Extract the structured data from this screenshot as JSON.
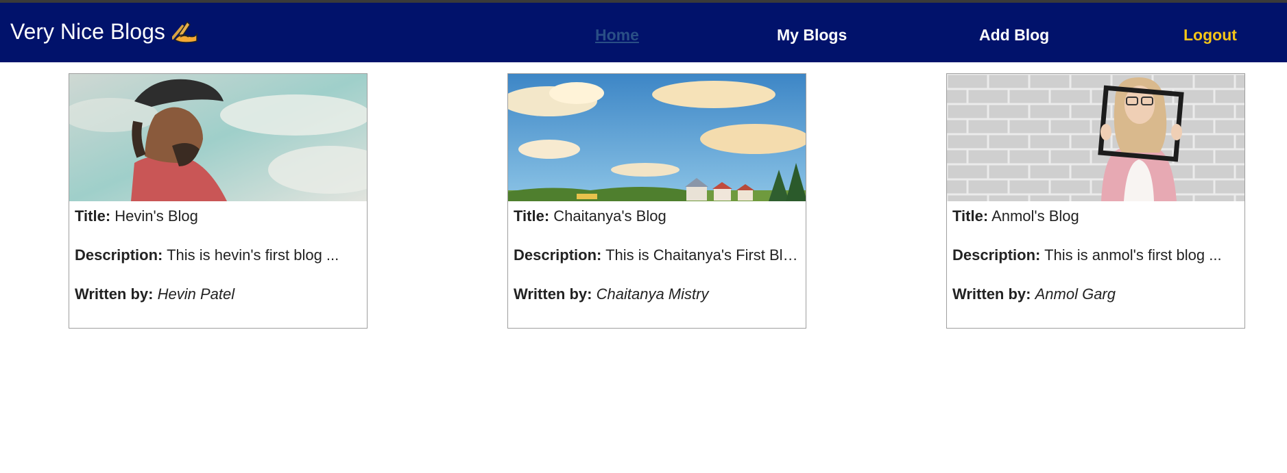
{
  "app": {
    "title": "Very Nice Blogs",
    "brand_icon": "writing-hand-icon"
  },
  "nav": {
    "home": "Home",
    "my_blogs": "My Blogs",
    "add_blog": "Add Blog",
    "logout": "Logout"
  },
  "labels": {
    "title": "Title:",
    "description": "Description:",
    "written_by": "Written by:"
  },
  "blogs": [
    {
      "title": "Hevin's Blog",
      "description": "This is hevin's first blog ...",
      "author": "Hevin Patel",
      "image": "man-in-cap-looking-at-sky"
    },
    {
      "title": "Chaitanya's Blog",
      "description": "This is Chaitanya's First Bl…",
      "author": "Chaitanya Mistry",
      "image": "painted-sky-over-village"
    },
    {
      "title": "Anmol's Blog",
      "description": "This is anmol's first blog ...",
      "author": "Anmol Garg",
      "image": "woman-holding-frame-brick-wall"
    }
  ],
  "colors": {
    "navbar_bg": "#01126b",
    "home_link": "#2a4f86",
    "logout_link": "#f5c518"
  }
}
